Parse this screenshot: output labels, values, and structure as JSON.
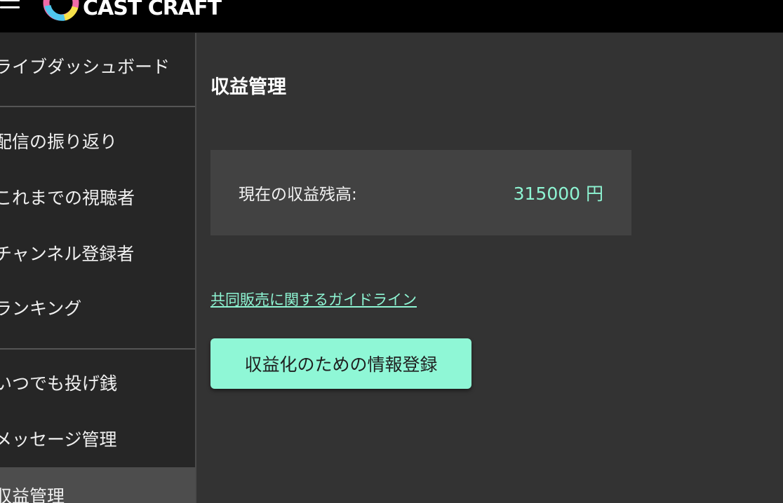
{
  "header": {
    "logo_text": "CAST CRAFT",
    "menu_icon": "hamburger-menu-icon"
  },
  "sidebar": {
    "items": [
      {
        "label": "ライブダッシュボード"
      },
      {
        "label": "配信の振り返り"
      },
      {
        "label": "これまでの視聴者"
      },
      {
        "label": "チャンネル登録者"
      },
      {
        "label": "ランキング"
      },
      {
        "label": "いつでも投げ銭"
      },
      {
        "label": "メッセージ管理"
      },
      {
        "label": "収益管理",
        "active": true
      }
    ]
  },
  "main": {
    "title": "収益管理",
    "balance": {
      "label": "現在の収益残高:",
      "value": "315000 円"
    },
    "guideline_link": "共同販売に関するガイドライン",
    "register_button": "収益化のための情報登録"
  },
  "colors": {
    "accent": "#8ef5d3",
    "topbar": "#000000",
    "sidebar": "#262626",
    "main_bg": "#333333",
    "card_bg": "#424242",
    "active_item": "#4d4d4d"
  }
}
